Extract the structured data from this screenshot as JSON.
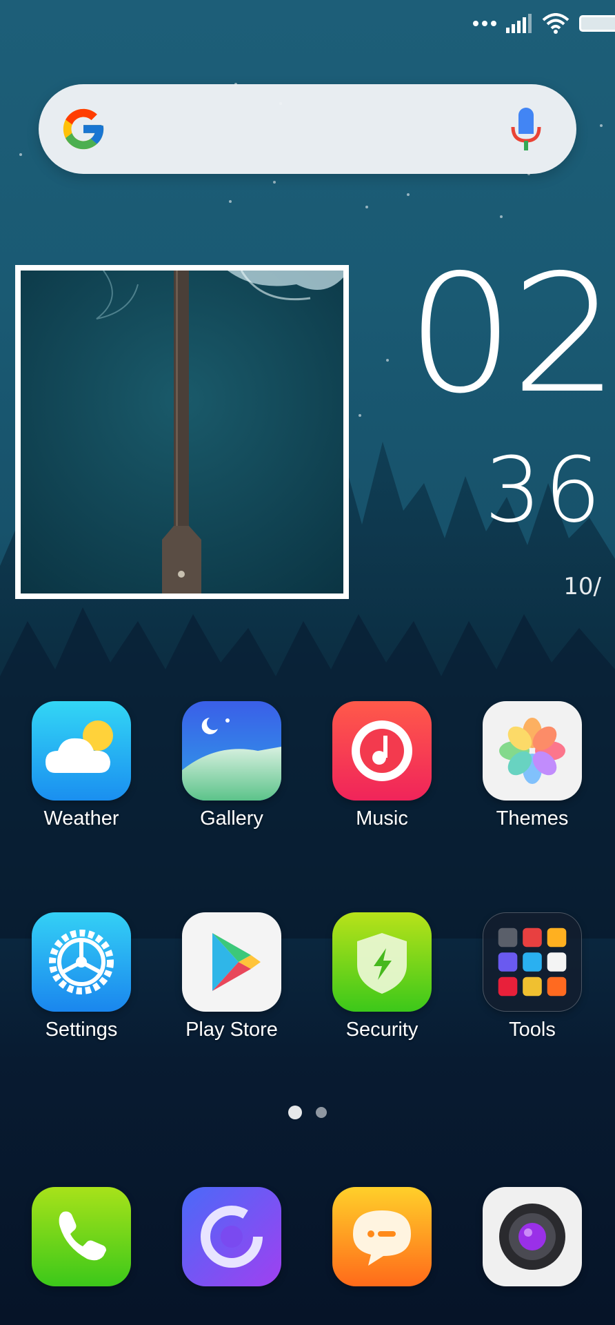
{
  "search": {
    "engine": "Google",
    "logo_icon": "google-g-icon",
    "mic_icon": "microphone-icon"
  },
  "clock": {
    "hour": "02",
    "minute": "36",
    "date": "10/"
  },
  "home_rows": [
    [
      {
        "label": "Weather",
        "icon": "weather-icon"
      },
      {
        "label": "Gallery",
        "icon": "gallery-icon"
      },
      {
        "label": "Music",
        "icon": "music-icon"
      },
      {
        "label": "Themes",
        "icon": "themes-icon"
      }
    ],
    [
      {
        "label": "Settings",
        "icon": "settings-icon"
      },
      {
        "label": "Play Store",
        "icon": "play-store-icon"
      },
      {
        "label": "Security",
        "icon": "security-icon"
      },
      {
        "label": "Tools",
        "icon": "tools-folder-icon"
      }
    ]
  ],
  "pager": {
    "pages": 2,
    "current": 1
  },
  "dock": [
    {
      "icon": "phone-icon"
    },
    {
      "icon": "browser-icon"
    },
    {
      "icon": "messaging-icon"
    },
    {
      "icon": "camera-icon"
    }
  ],
  "colors": {
    "wallpaper_top": "#1d5e78",
    "wallpaper_bottom": "#061428"
  }
}
